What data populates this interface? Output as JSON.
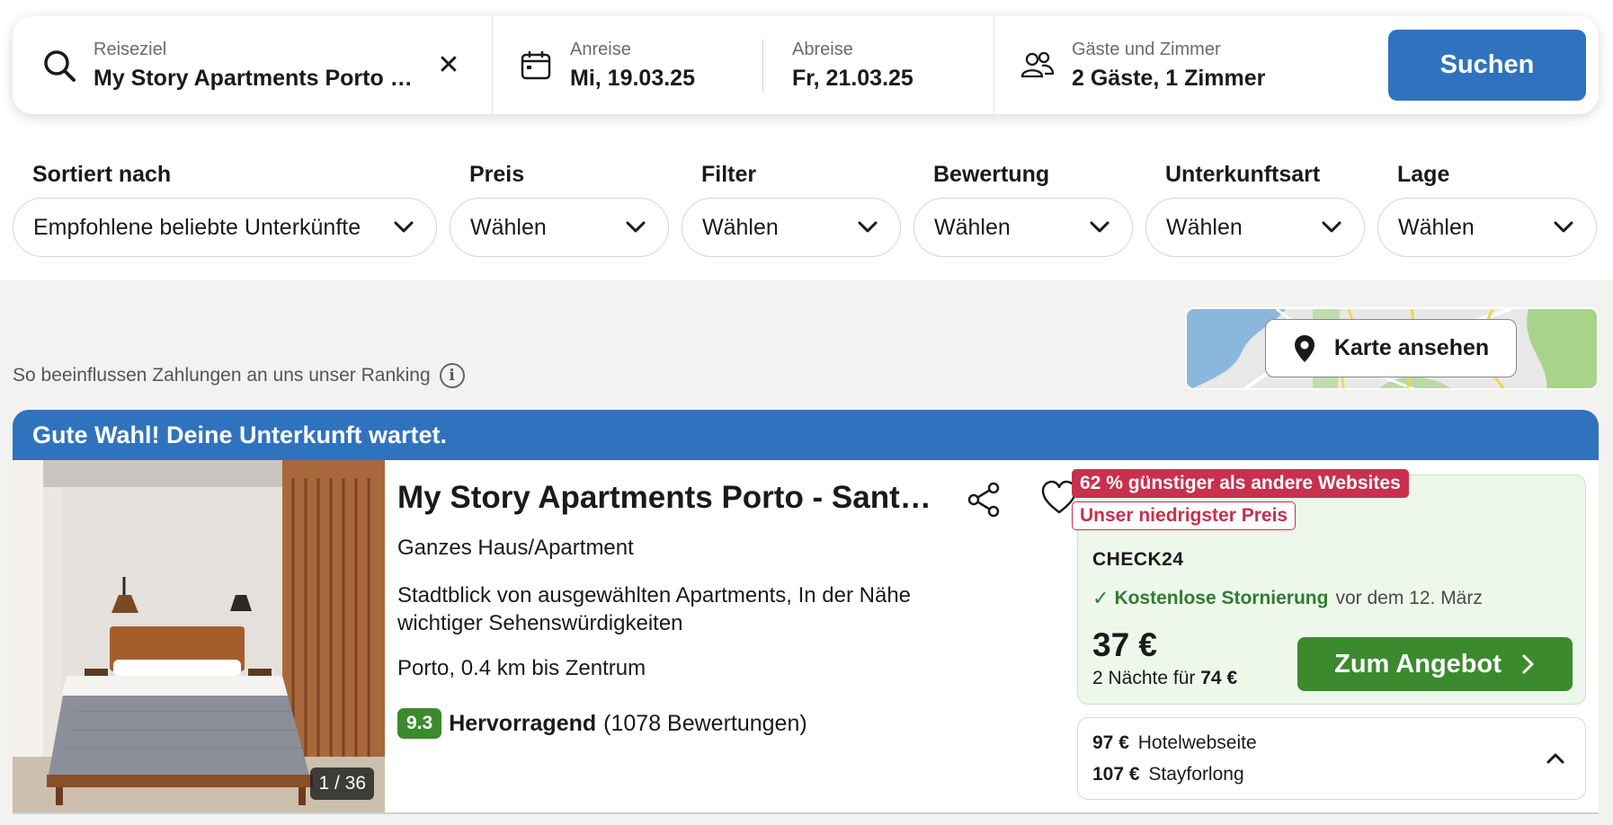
{
  "search": {
    "destination_label": "Reiseziel",
    "destination_value": "My Story Apartments Porto - Santa Catarina",
    "clear_symbol": "✕",
    "checkin_label": "Anreise",
    "checkin_value": "Mi, 19.03.25",
    "checkout_label": "Abreise",
    "checkout_value": "Fr, 21.03.25",
    "guests_label": "Gäste und Zimmer",
    "guests_value": "2 Gäste, 1 Zimmer",
    "search_button": "Suchen",
    "accent_color": "#2f73bf"
  },
  "filters": [
    {
      "label": "Sortiert nach",
      "value": "Empfohlene beliebte Unterkünfte"
    },
    {
      "label": "Preis",
      "value": "Wählen"
    },
    {
      "label": "Filter",
      "value": "Wählen"
    },
    {
      "label": "Bewertung",
      "value": "Wählen"
    },
    {
      "label": "Unterkunftsart",
      "value": "Wählen"
    },
    {
      "label": "Lage",
      "value": "Wählen"
    }
  ],
  "ranking_note": "So beeinflussen Zahlungen an uns unser Ranking",
  "info_symbol": "i",
  "map_button": "Karte ansehen",
  "listing": {
    "banner": "Gute Wahl! Deine Unterkunft wartet.",
    "photo_counter": "1 / 36",
    "title": "My Story Apartments Porto - Santa Catarina",
    "type": "Ganzes Haus/Apartment",
    "description": "Stadtblick von ausgewählten Apartments, In der Nähe wichtiger Sehenswürdigkeiten",
    "location": "Porto, 0.4 km bis Zentrum",
    "rating_score": "9.3",
    "rating_label": "Hervorragend",
    "rating_count": "(1078 Bewertungen)",
    "badge_discount": "62 % günstiger als andere Websites",
    "badge_lowest": "Unser niedrigster Preis",
    "offer": {
      "provider": "CHECK24",
      "checkmark": "✓",
      "cancellation": "Kostenlose Stornierung",
      "cancellation_deadline": "vor dem 12. März",
      "price": "37 €",
      "nights_text": "2 Nächte für",
      "total": "74 €",
      "deal_button": "Zum Angebot"
    },
    "other_offers": [
      {
        "price": "97 €",
        "site": "Hotelwebseite"
      },
      {
        "price": "107 €",
        "site": "Stayforlong"
      }
    ],
    "colors": {
      "deal_green": "#3c8a2e",
      "badge_red": "#c8304d",
      "offer_bg": "#edf8ea"
    }
  }
}
